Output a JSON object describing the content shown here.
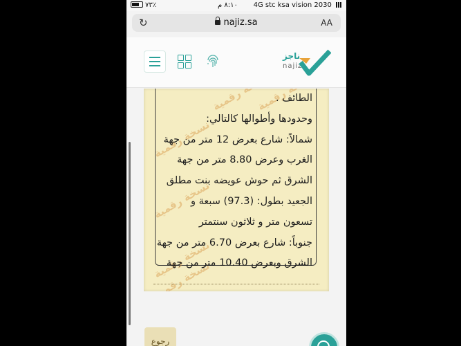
{
  "status_bar": {
    "carrier": "stc ksa vision 2030",
    "network": "4G",
    "time": "٨:١٠ م",
    "battery": "٧٣٪"
  },
  "browser": {
    "url": "najiz.sa",
    "text_size_button": "AA",
    "reload_icon": "reload-icon"
  },
  "header": {
    "logo_ar": "ناجز",
    "logo_en": "najiz",
    "icons": [
      "menu-icon",
      "apps-grid-icon",
      "fingerprint-icon"
    ]
  },
  "document": {
    "watermark": "نسخة رقمية",
    "lines": [
      "الطائف .",
      "وحدودها وأطوالها كالتالي:",
      "شمالاً: شارع بعرض 12 متر من جهة",
      "الغرب وعرض 8.80 متر من جهة",
      "الشرق ثم حوش عويضه بنت مطلق",
      "الجعيد بطول: (97.3) سبعة و",
      "تسعون متر و ثلاثون سنتمتر",
      "جنوباً: شارع بعرض 6.70 متر من جهة",
      "الشرق وبعرض 10.40 متر من جهة"
    ]
  },
  "footer": {
    "back_label": "رجوع"
  },
  "colors": {
    "accent": "#2aa198",
    "paper": "#f5edc2"
  }
}
